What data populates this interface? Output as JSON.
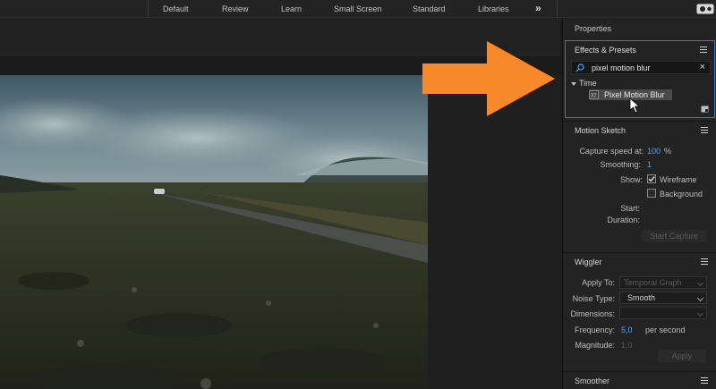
{
  "workspace_tabs": [
    "Default",
    "Review",
    "Learn",
    "Small Screen",
    "Standard",
    "Libraries"
  ],
  "workspace_more": "»",
  "properties_title": "Properties",
  "effects_presets": {
    "title": "Effects & Presets",
    "search_value": "pixel motion blur",
    "category": "Time",
    "result": "Pixel Motion Blur"
  },
  "motion_sketch": {
    "title": "Motion Sketch",
    "capture_speed_label": "Capture speed at:",
    "capture_speed_value": "100",
    "capture_speed_unit": "%",
    "smoothing_label": "Smoothing:",
    "smoothing_value": "1",
    "show_label": "Show:",
    "wireframe_label": "Wireframe",
    "background_label": "Background",
    "start_label": "Start:",
    "duration_label": "Duration:",
    "start_capture_label": "Start Capture"
  },
  "wiggler": {
    "title": "Wiggler",
    "apply_to_label": "Apply To:",
    "apply_to_value": "Temporal Graph",
    "noise_type_label": "Noise Type:",
    "noise_type_value": "Smooth",
    "dimensions_label": "Dimensions:",
    "frequency_label": "Frequency:",
    "frequency_value": "5,0",
    "frequency_unit": "per second",
    "magnitude_label": "Magnitude:",
    "magnitude_value": "1,0",
    "apply_label": "Apply"
  },
  "smoother": {
    "title": "Smoother"
  },
  "colors": {
    "accent_blue": "#2f7ad6",
    "value_blue": "#4aa3ff",
    "arrow_orange": "#f7892b"
  }
}
